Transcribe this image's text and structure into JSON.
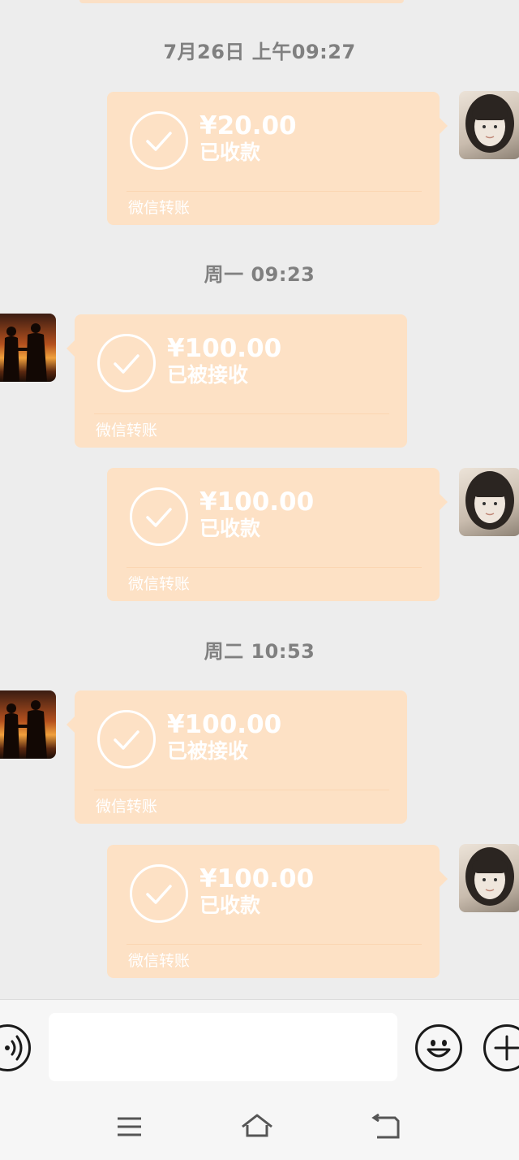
{
  "chat": {
    "timestamps": [
      "7月26日 上午09:27",
      "周一 09:23",
      "周二 10:53"
    ],
    "messages": [
      {
        "side": "right",
        "amount": "¥20.00",
        "status": "已收款",
        "footer": "微信转账"
      },
      {
        "side": "left",
        "amount": "¥100.00",
        "status": "已被接收",
        "footer": "微信转账"
      },
      {
        "side": "right",
        "amount": "¥100.00",
        "status": "已收款",
        "footer": "微信转账"
      },
      {
        "side": "left",
        "amount": "¥100.00",
        "status": "已被接收",
        "footer": "微信转账"
      },
      {
        "side": "right",
        "amount": "¥100.00",
        "status": "已收款",
        "footer": "微信转账"
      }
    ]
  },
  "input_bar": {
    "voice_icon": "voice-icon",
    "emoji_icon": "emoji-icon",
    "plus_icon": "plus-icon",
    "text_value": ""
  },
  "nav_bar": {
    "icons": [
      "menu-icon",
      "home-icon",
      "back-icon"
    ]
  },
  "colors": {
    "background": "#ededed",
    "transfer_bubble": "#fde1c5",
    "timestamp_text": "#808080"
  }
}
